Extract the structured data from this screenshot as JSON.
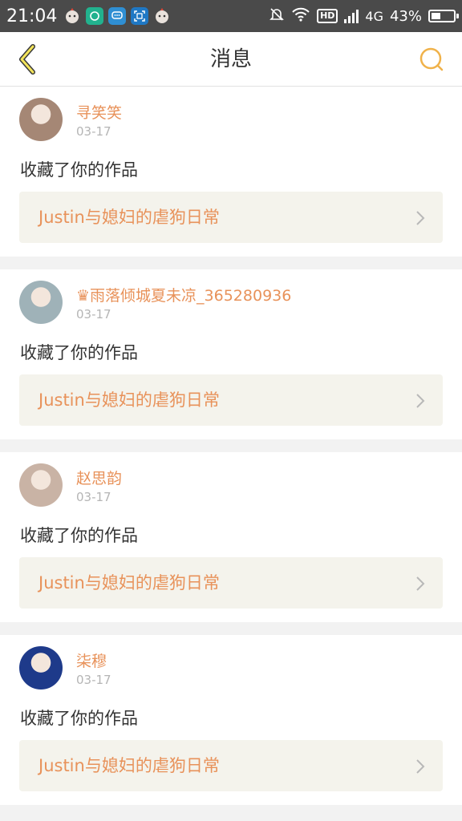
{
  "status": {
    "time": "21:04",
    "network": "4G",
    "battery_text": "43%",
    "battery_level": 0.43,
    "hd": "HD"
  },
  "navbar": {
    "title": "消息",
    "accent": "#f0b24a"
  },
  "messages": [
    {
      "user": "寻笑笑",
      "date": "03-17",
      "action": "收藏了你的作品",
      "work": "Justin与媳妇的虐狗日常",
      "avatar_color": "#a58775"
    },
    {
      "user": "♛雨落倾城夏未凉_365280936",
      "date": "03-17",
      "action": "收藏了你的作品",
      "work": "Justin与媳妇的虐狗日常",
      "avatar_color": "#9fb2b8"
    },
    {
      "user": "赵思韵",
      "date": "03-17",
      "action": "收藏了你的作品",
      "work": "Justin与媳妇的虐狗日常",
      "avatar_color": "#c9b3a5"
    },
    {
      "user": "柒穆",
      "date": "03-17",
      "action": "收藏了你的作品",
      "work": "Justin与媳妇的虐狗日常",
      "avatar_color": "#1e3a8a"
    }
  ]
}
